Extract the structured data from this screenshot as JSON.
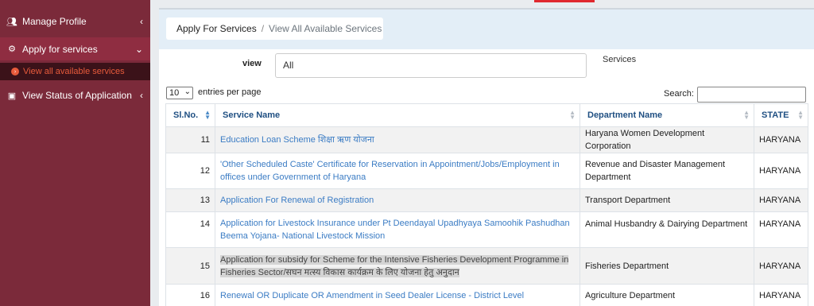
{
  "sidebar": {
    "items": [
      {
        "label": "Manage Profile",
        "icon": "users-icon"
      },
      {
        "label": "Apply for services",
        "icon": "gears-icon"
      },
      {
        "label": "View Status of Application",
        "icon": "file-icon"
      }
    ],
    "subitem": {
      "label": "View all available services"
    }
  },
  "breadcrumb": {
    "first": "Apply For Services",
    "separator": "/",
    "current": "View All Available Services"
  },
  "filter": {
    "view_label": "view",
    "view_value": "All",
    "services_label": "Services"
  },
  "table_controls": {
    "length_value": "10",
    "length_label": "entries per page",
    "search_label": "Search:",
    "search_value": ""
  },
  "table": {
    "headers": [
      "Sl.No.",
      "Service Name",
      "Department Name",
      "STATE"
    ],
    "rows": [
      {
        "no": "11",
        "service": "Education Loan Scheme शिक्षा ऋण योजना",
        "dept": "Haryana Women Development Corporation",
        "state": "HARYANA"
      },
      {
        "no": "12",
        "service": "'Other Scheduled Caste' Certificate for Reservation in Appointment/Jobs/Employment in offices under Government of Haryana",
        "dept": "Revenue and Disaster Management Department",
        "state": "HARYANA"
      },
      {
        "no": "13",
        "service": "Application For Renewal of Registration",
        "dept": "Transport Department",
        "state": "HARYANA"
      },
      {
        "no": "14",
        "service": "Application for Livestock Insurance under Pt Deendayal Upadhyaya Samoohik Pashudhan Beema Yojana- National Livestock Mission",
        "dept": "Animal Husbandry & Dairying Department",
        "state": "HARYANA"
      },
      {
        "no": "15",
        "service": "Application for subsidy for Scheme for the Intensive Fisheries Development Programme in Fisheries Sector/सघन मत्स्य विकास कार्यक्रम के लिए योजना हेतु अनुदान",
        "dept": "Fisheries Department",
        "state": "HARYANA"
      },
      {
        "no": "16",
        "service": "Renewal OR Duplicate OR Amendment in Seed Dealer License - District Level",
        "dept": "Agriculture Department",
        "state": "HARYANA"
      }
    ]
  },
  "colors": {
    "sidebar": "#7b2a3a",
    "active": "#8f2d41",
    "link": "#3b7cc4",
    "header_text": "#1f4f82",
    "accent_red": "#e0282e"
  }
}
